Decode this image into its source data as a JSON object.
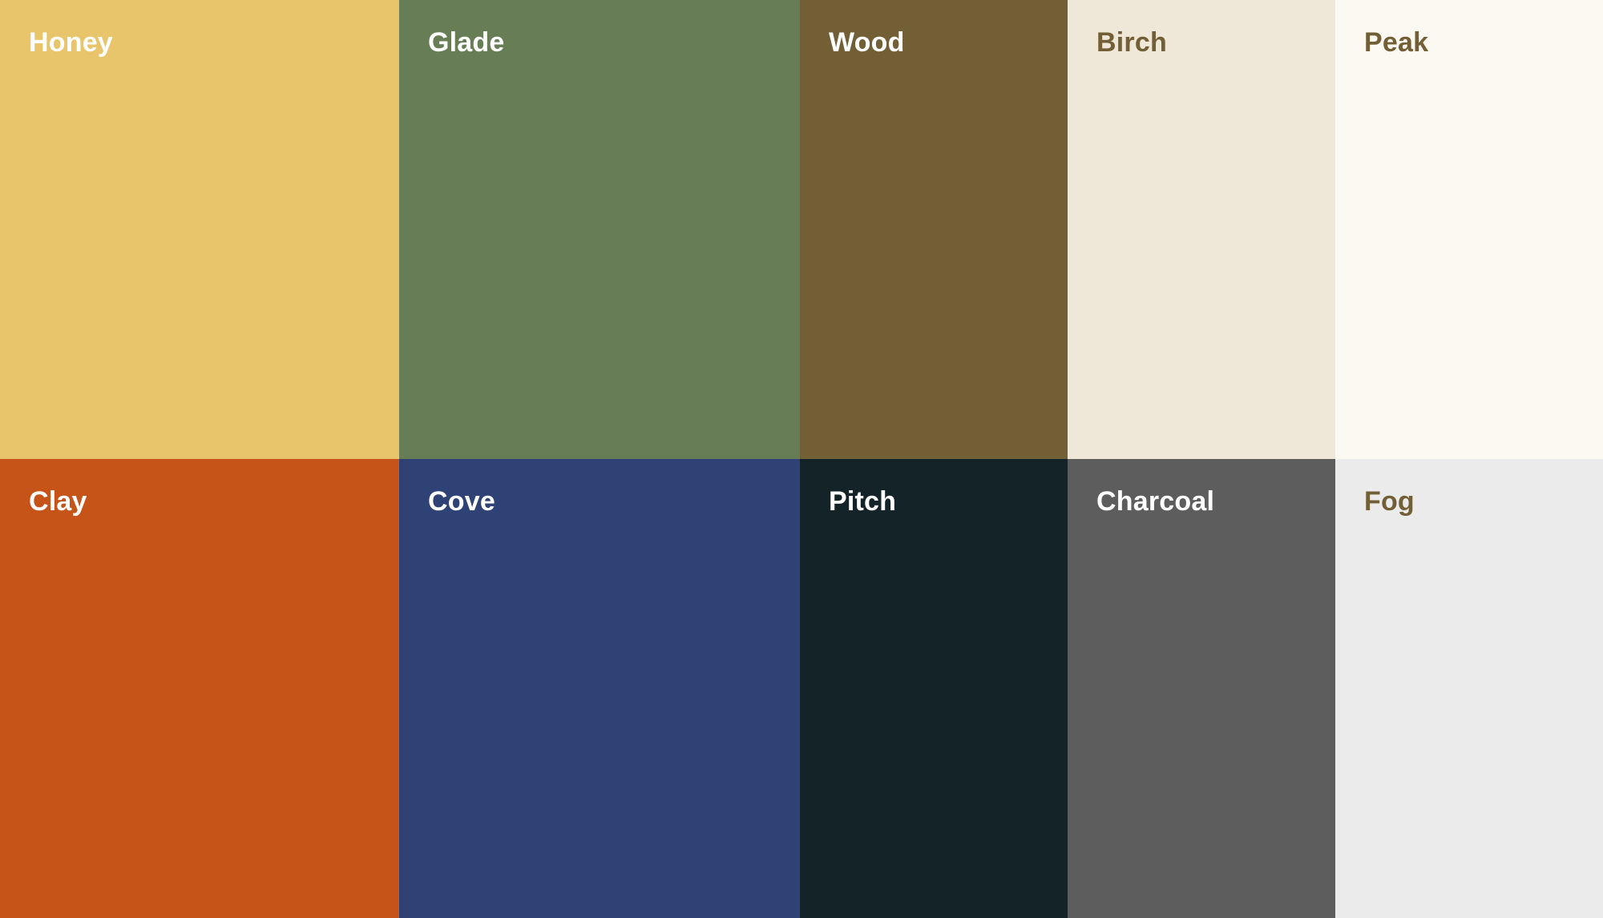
{
  "swatches": [
    {
      "label": "Honey",
      "color": "#E8C46A",
      "text_color": "#FFFFFF"
    },
    {
      "label": "Glade",
      "color": "#667D56",
      "text_color": "#FFFFFF"
    },
    {
      "label": "Wood",
      "color": "#725F35",
      "text_color": "#FFFFFF"
    },
    {
      "label": "Birch",
      "color": "#EFE8D8",
      "text_color": "#725F35"
    },
    {
      "label": "Peak",
      "color": "#FCF9F3",
      "text_color": "#725F35"
    },
    {
      "label": "Clay",
      "color": "#C65317",
      "text_color": "#FFFFFF"
    },
    {
      "label": "Cove",
      "color": "#2E4275",
      "text_color": "#FFFFFF"
    },
    {
      "label": "Pitch",
      "color": "#132328",
      "text_color": "#FFFFFF"
    },
    {
      "label": "Charcoal",
      "color": "#5D5D5D",
      "text_color": "#FFFFFF"
    },
    {
      "label": "Fog",
      "color": "#EBEBEC",
      "text_color": "#725F35"
    }
  ]
}
